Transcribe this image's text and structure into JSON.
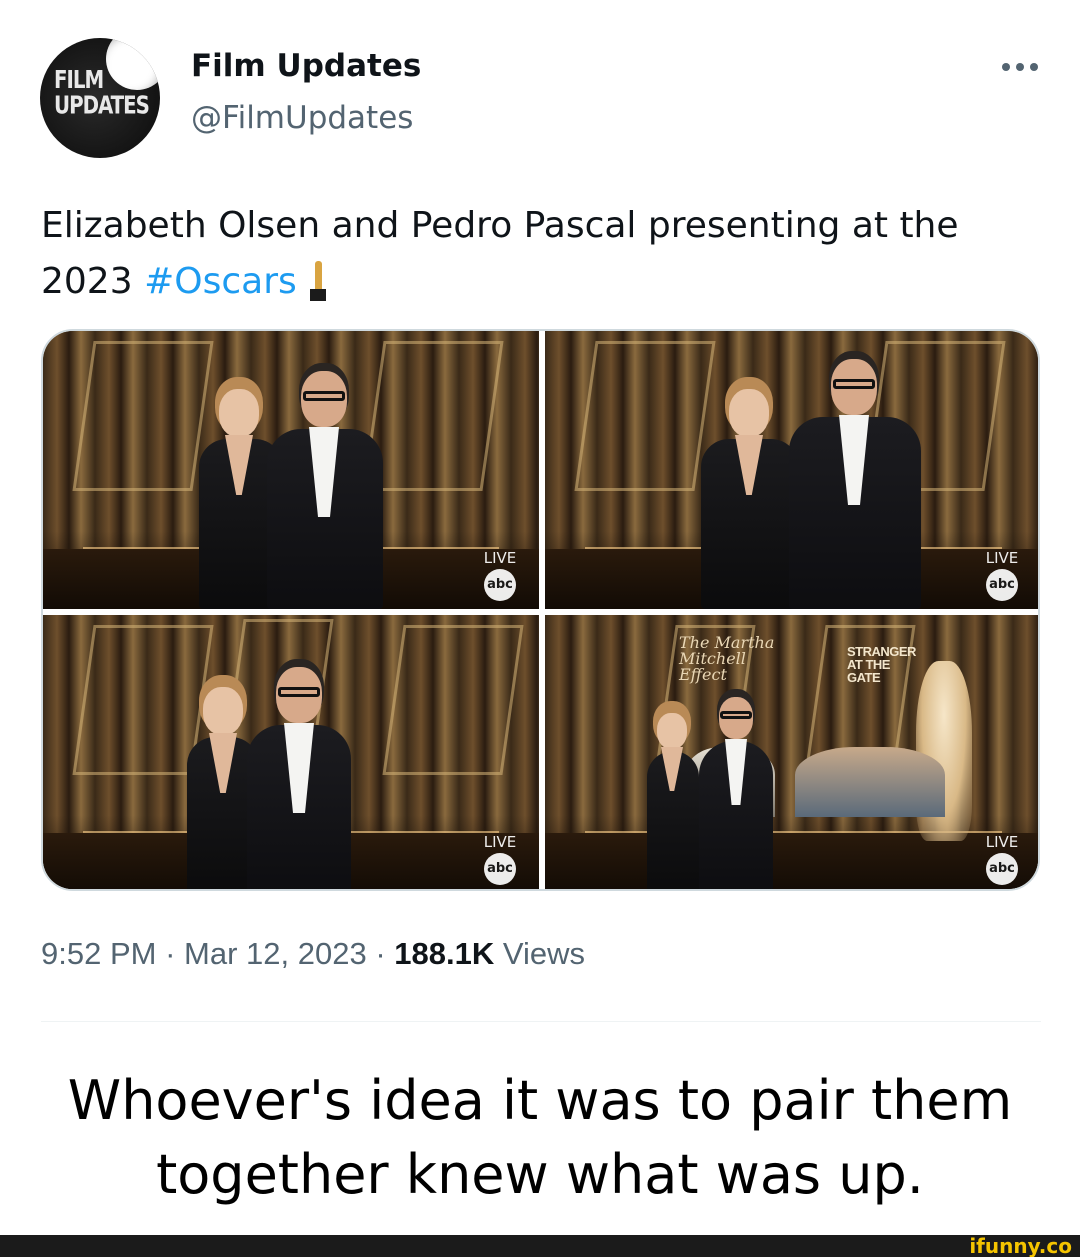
{
  "author": {
    "name": "Film Updates",
    "handle": "@FilmUpdates",
    "avatar_text": [
      "FILM",
      "UPDATES"
    ]
  },
  "tweet": {
    "text": "Elizabeth Olsen and Pedro Pascal presenting at the 2023",
    "hashtag": "#Oscars",
    "emoji": "oscar-statue-emoji"
  },
  "media": {
    "live_label": "LIVE",
    "network_label": "abc",
    "screen_title_1": "The Martha Mitchell Effect",
    "screen_title_2": "STRANGER AT THE GATE"
  },
  "meta": {
    "time": "9:52 PM",
    "date": "Mar 12, 2023",
    "separator": "·",
    "views_count": "188.1K",
    "views_label": "Views"
  },
  "caption": {
    "line1": "Whoever's idea it was to pair them",
    "line2": "together knew what was up."
  },
  "footer": {
    "watermark": "ifunny.co"
  },
  "colors": {
    "link": "#1d9bf0",
    "secondary_text": "#536471",
    "primary_text": "#0f1419",
    "watermark": "#f5c400"
  }
}
